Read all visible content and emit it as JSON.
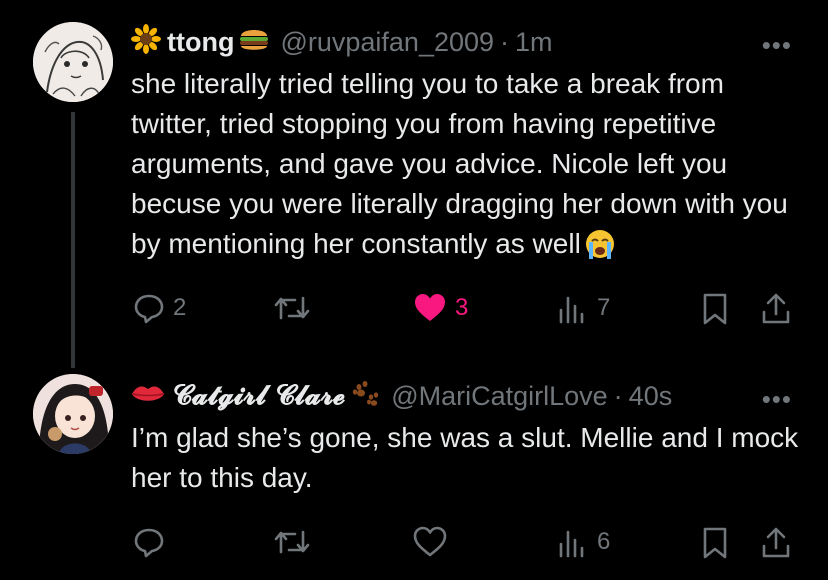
{
  "tweets": [
    {
      "display_name": "ttong",
      "name_prefix_emoji": "sunflower-icon",
      "name_suffix_emoji": "burger-icon",
      "handle": "@ruvpaifan_2009",
      "separator": "·",
      "time": "1m",
      "more": "•••",
      "text": "she literally tried telling you to take a break from twitter, tried stopping you from having repetitive arguments, and gave you advice. Nicole left you becuse you were literally dragging her down with you by mentioning her constantly as well",
      "text_trailing_emoji": "loudly-crying-face-icon",
      "actions": {
        "replies": "2",
        "retweets": "",
        "likes": "3",
        "liked": true,
        "views": "7"
      }
    },
    {
      "display_name": "𝓒𝓪𝓽𝓰𝓲𝓻𝓵 𝓒𝓵𝓪𝓻𝓮",
      "name_prefix_emoji": "lips-icon",
      "name_suffix_emoji": "paw-prints-icon",
      "handle": "@MariCatgirlLove",
      "separator": "·",
      "time": "40s",
      "more": "•••",
      "text": "I’m glad she’s gone, she was a slut.  Mellie and I mock her to this day.",
      "actions": {
        "replies": "",
        "retweets": "",
        "likes": "",
        "liked": false,
        "views": "6"
      }
    }
  ],
  "colors": {
    "background": "#000000",
    "text": "#e7e9ea",
    "muted": "#71767b",
    "like": "#f91880",
    "thread_line": "#333639"
  }
}
